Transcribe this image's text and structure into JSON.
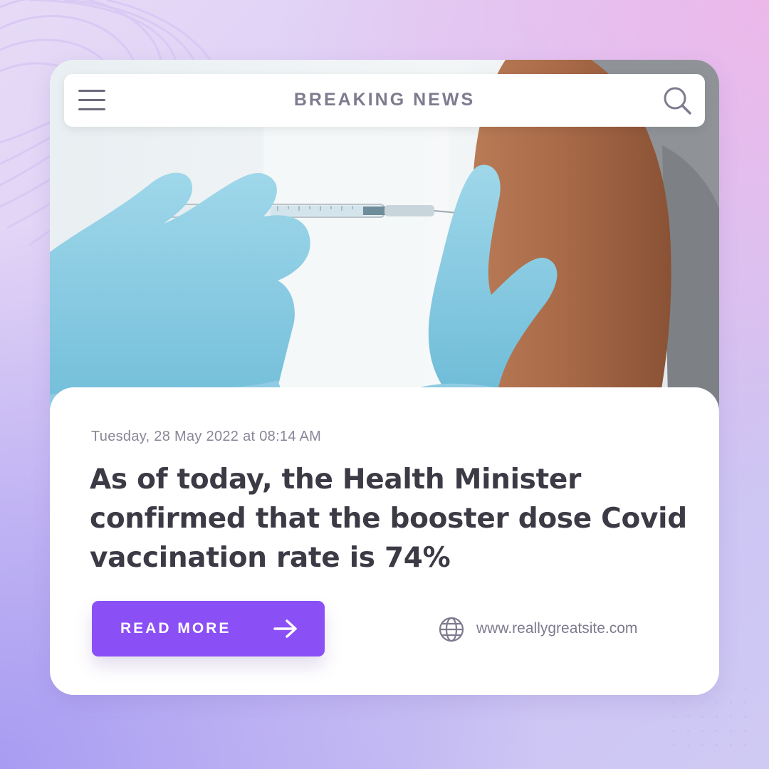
{
  "header": {
    "title": "BREAKING NEWS",
    "menu_icon": "hamburger-menu-icon",
    "search_icon": "search-icon"
  },
  "article": {
    "image": "vaccine-injection-photo",
    "timestamp": "Tuesday, 28 May 2022 at 08:14 AM",
    "headline": "As of today, the Health Minister confirmed that the booster dose Covid vaccination rate is 74%"
  },
  "cta": {
    "label": "READ MORE",
    "icon": "arrow-right-icon"
  },
  "footer": {
    "website": "www.reallygreatsite.com",
    "icon": "globe-icon"
  },
  "colors": {
    "accent": "#8b4ff6",
    "headline": "#3c3a45",
    "muted": "#8a8698"
  }
}
